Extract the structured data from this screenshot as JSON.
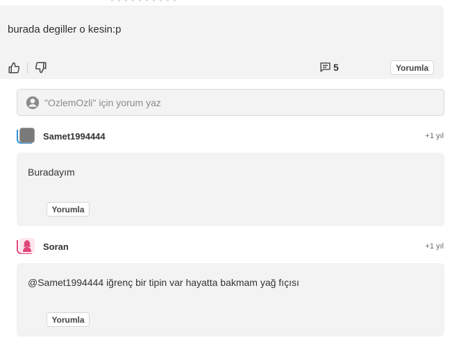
{
  "post": {
    "text": "burada degiller o kesin:p",
    "comment_count": "5",
    "reply_label": "Yorumla",
    "icons": {
      "like": "thumbs-up-icon",
      "dislike": "thumbs-down-icon",
      "comments": "comment-icon"
    }
  },
  "comment_input": {
    "placeholder": "\"OzlemOzli\" için yorum yaz",
    "avatar_icon": "user-avatar-icon"
  },
  "replies": [
    {
      "username": "Samet1994444",
      "time": "+1 yıl",
      "text": "Buradayım",
      "reply_label": "Yorumla",
      "accent": "#2f8fd8"
    },
    {
      "username": "Soran",
      "time": "+1 yıl",
      "text": "@Samet1994444 iğrenç bir tipin var hayatta bakmam yağ fıçısı",
      "reply_label": "Yorumla",
      "accent": "#e0457b"
    }
  ]
}
